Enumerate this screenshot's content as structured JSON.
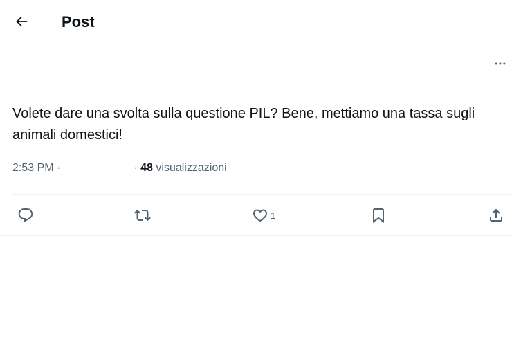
{
  "header": {
    "title": "Post",
    "back_icon": "arrow-left-icon"
  },
  "post": {
    "more_icon": "more-horizontal-icon",
    "text": "Volete dare una svolta sulla questione PIL? Bene, mettiamo una tassa sugli animali domestici!",
    "time": "2:53 PM",
    "separator_1": " ·",
    "separator_2": "· ",
    "views_count": "48",
    "views_label": " visualizzazioni"
  },
  "actions": {
    "reply_icon": "reply-icon",
    "repost_icon": "repost-icon",
    "like_icon": "heart-icon",
    "like_count": "1",
    "bookmark_icon": "bookmark-icon",
    "share_icon": "share-icon"
  },
  "colors": {
    "text": "#0f1419",
    "secondary": "#536471",
    "divider": "#eff3f4"
  }
}
